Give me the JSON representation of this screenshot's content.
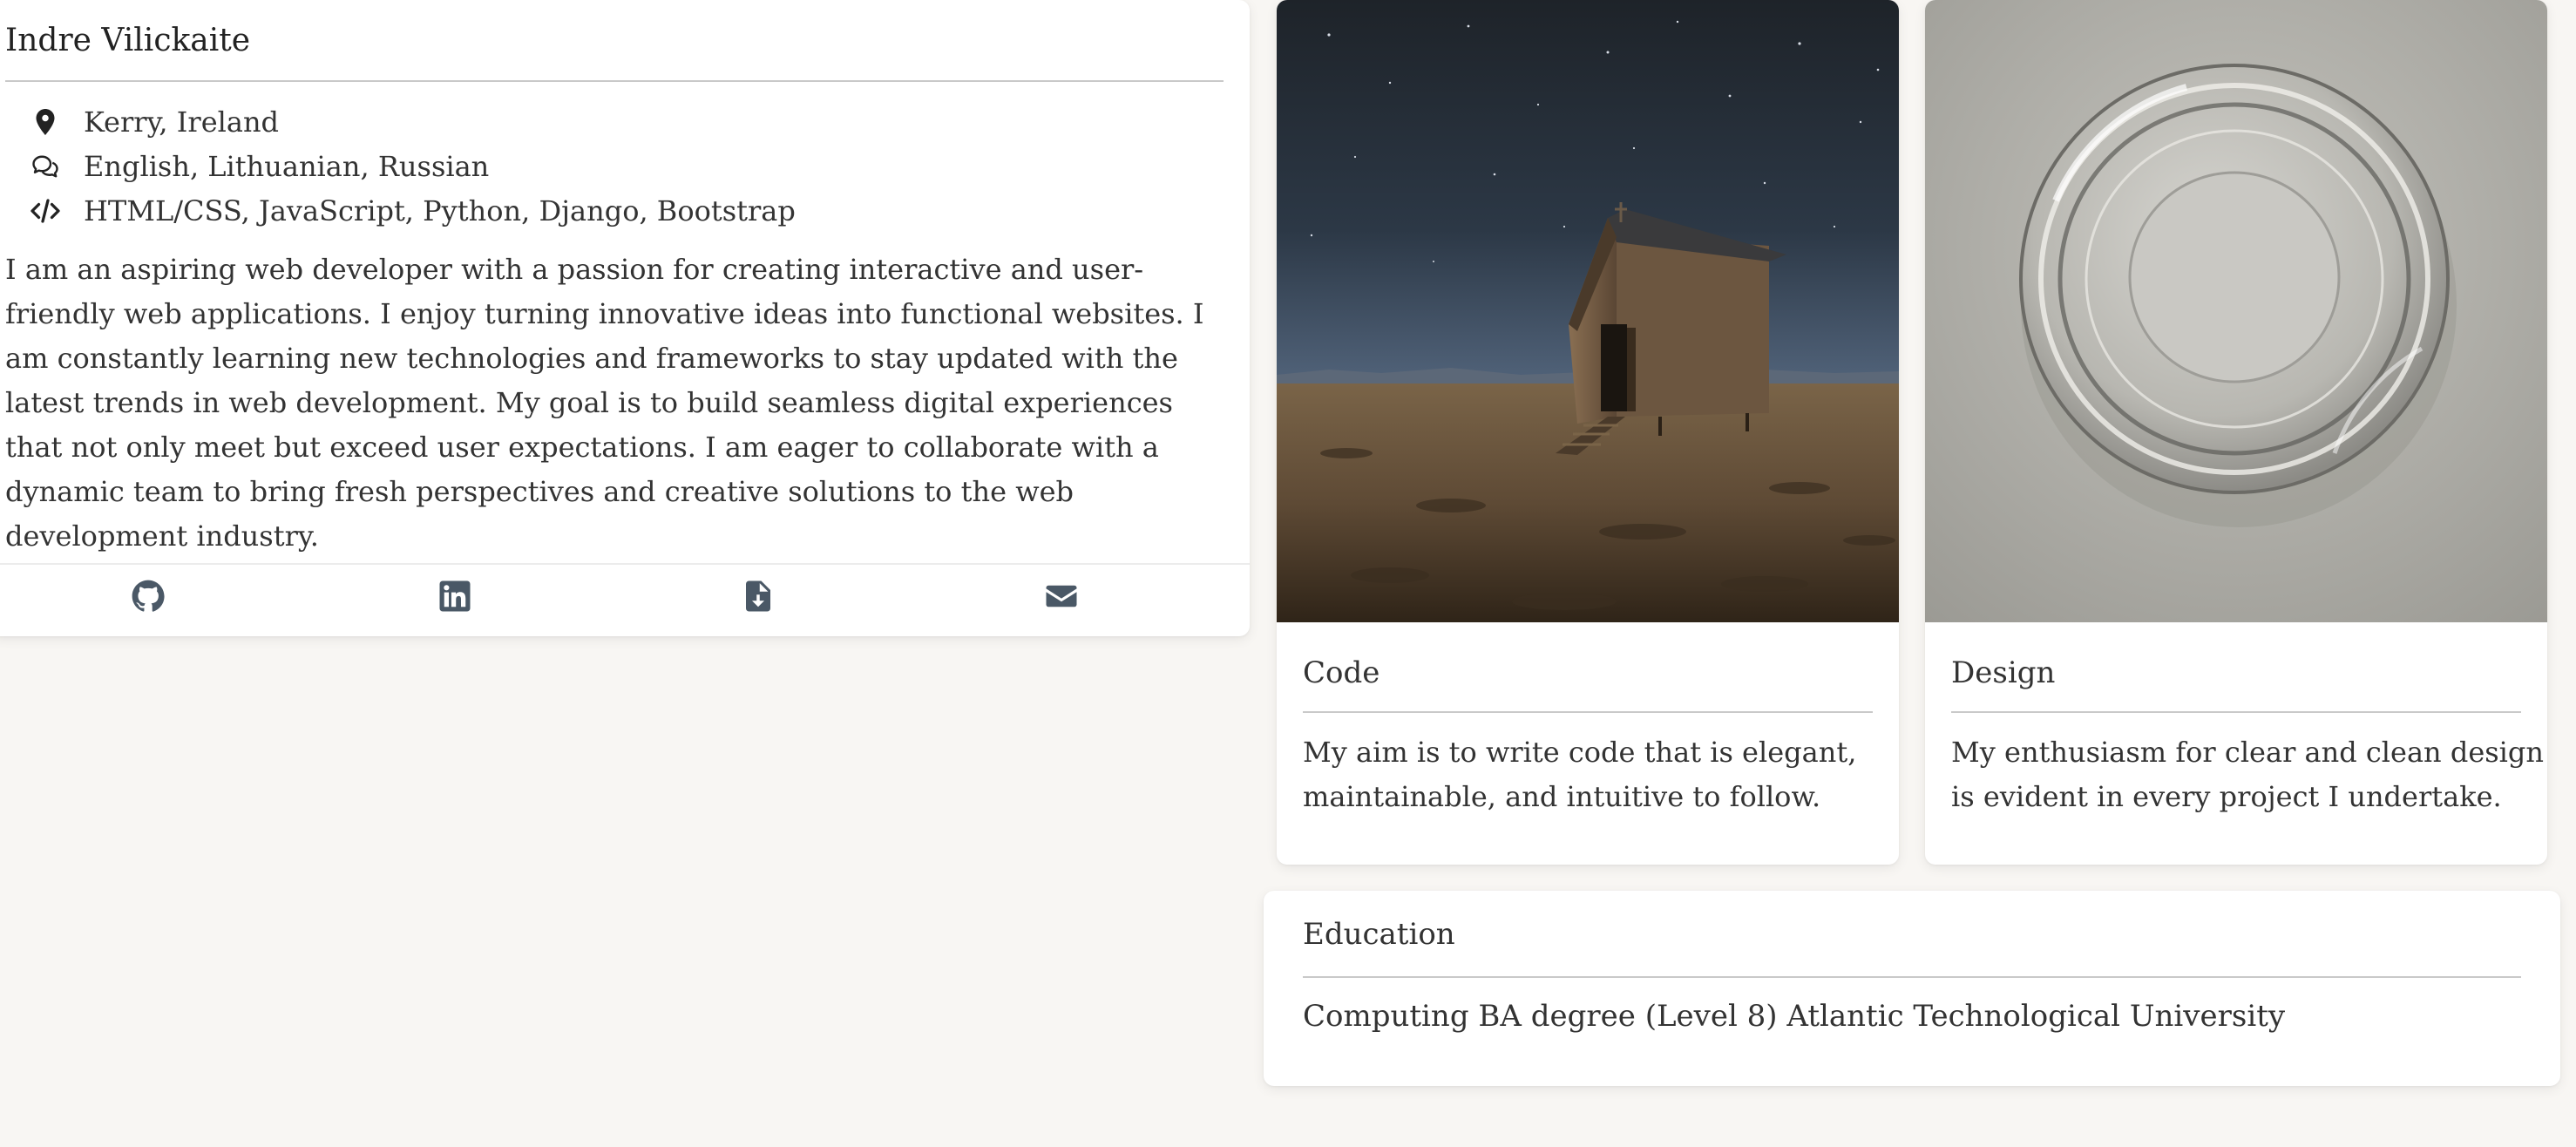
{
  "profile": {
    "name": "Indre Vilickaite",
    "location": "Kerry, Ireland",
    "languages": "English, Lithuanian, Russian",
    "skills": "HTML/CSS, JavaScript, Python, Django, Bootstrap",
    "bio": "I am an aspiring web developer with a passion for creating interactive and user-friendly web applications. I enjoy turning innovative ideas into functional websites. I am constantly learning new technologies and frameworks to stay updated with the latest trends in web development. My goal is to build seamless digital experiences that not only meet but exceed user expectations. I am eager to collaborate with a dynamic team to bring fresh perspectives and creative solutions to the web development industry.",
    "icons": {
      "location": "map-pin-icon",
      "languages": "chat-bubbles-icon",
      "skills": "code-brackets-icon"
    },
    "social": [
      "github-icon",
      "linkedin-icon",
      "file-download-icon",
      "envelope-icon"
    ]
  },
  "cards": {
    "code": {
      "title": "Code",
      "text": "My aim is to write code that is elegant, maintainable, and intuitive to follow."
    },
    "design": {
      "title": "Design",
      "text": "My enthusiasm for clear and clean design is evident in every project I undertake."
    }
  },
  "education": {
    "title": "Education",
    "text": "Computing BA degree (Level 8) Atlantic Technological University"
  },
  "colors": {
    "background": "#f8f6f3",
    "card": "#ffffff",
    "icon": "#4a5866",
    "text": "#333333"
  }
}
